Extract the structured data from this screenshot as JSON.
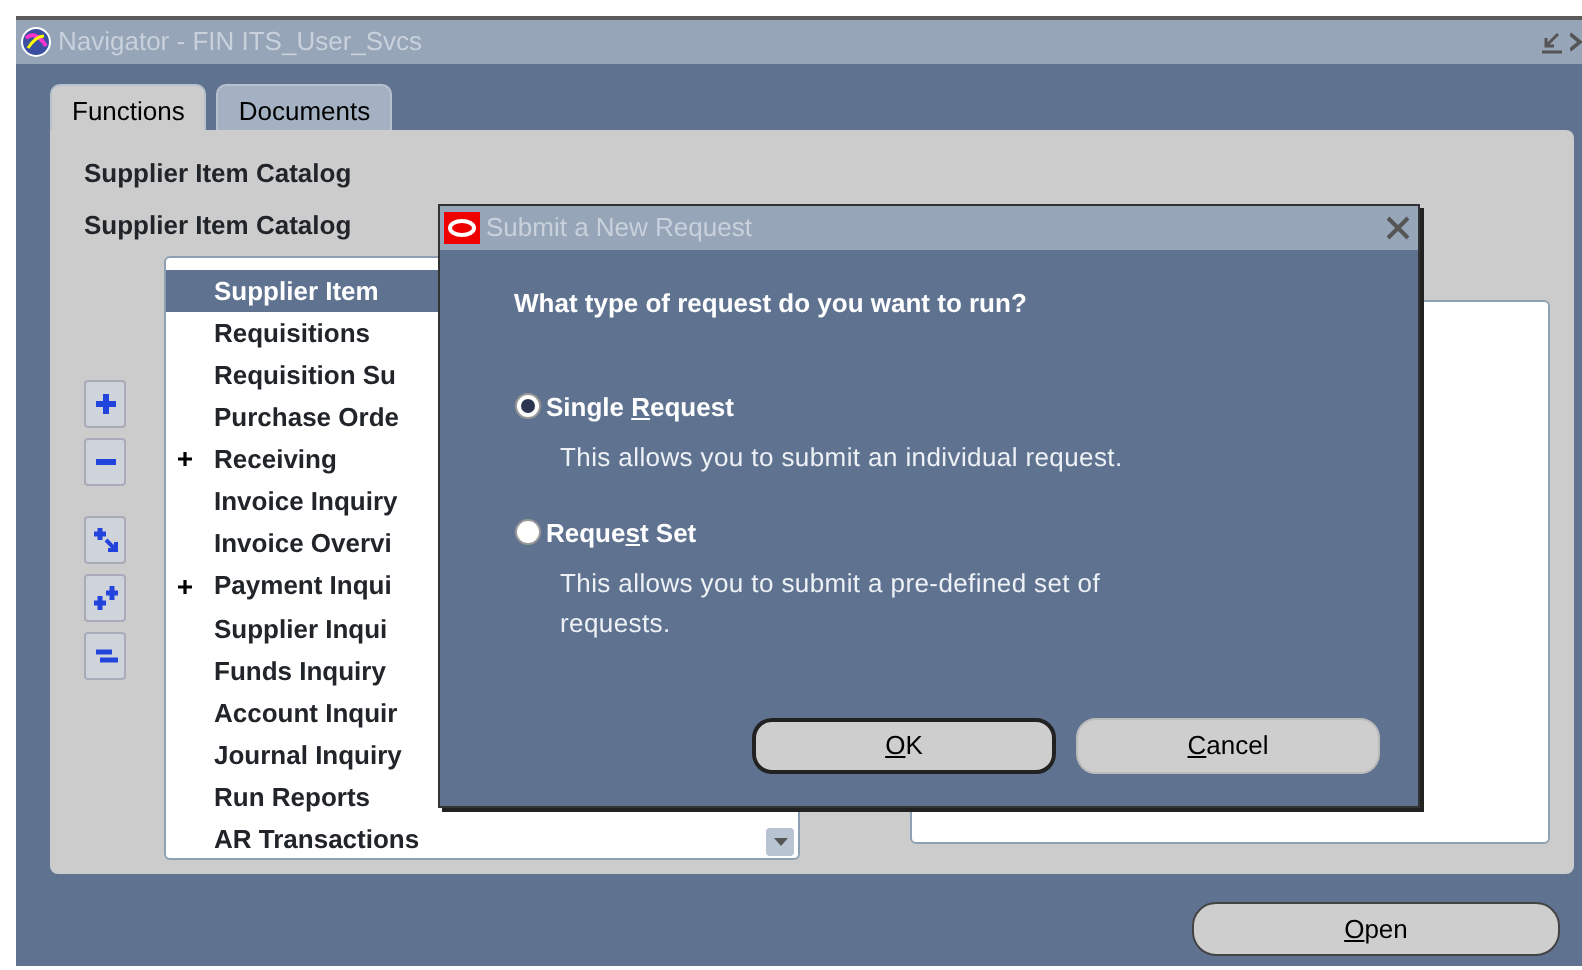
{
  "window": {
    "title": "Navigator - FIN ITS_User_Svcs"
  },
  "tabs": [
    {
      "label": "Functions",
      "selected": true
    },
    {
      "label": "Documents",
      "selected": false
    }
  ],
  "headings": [
    "Supplier Item Catalog",
    "Supplier Item Catalog"
  ],
  "tree_tools": [
    {
      "kind": "expand"
    },
    {
      "kind": "collapse"
    },
    {
      "kind": "expand_branch"
    },
    {
      "kind": "expand_all"
    },
    {
      "kind": "collapse_all"
    }
  ],
  "tree": {
    "items": [
      {
        "label": "Supplier Item",
        "selected": true,
        "collapsed": false
      },
      {
        "label": "Requisitions",
        "selected": false,
        "collapsed": false
      },
      {
        "label": "Requisition Su",
        "selected": false,
        "collapsed": false
      },
      {
        "label": "Purchase Orde",
        "selected": false,
        "collapsed": false
      },
      {
        "label": "Receiving",
        "selected": false,
        "collapsed": true
      },
      {
        "label": "Invoice Inquiry",
        "selected": false,
        "collapsed": false
      },
      {
        "label": "Invoice Overvi",
        "selected": false,
        "collapsed": false
      },
      {
        "label": "Payment Inqui",
        "selected": false,
        "collapsed": true
      },
      {
        "label": "Supplier Inqui",
        "selected": false,
        "collapsed": false
      },
      {
        "label": "Funds Inquiry",
        "selected": false,
        "collapsed": false
      },
      {
        "label": "Account Inquir",
        "selected": false,
        "collapsed": false
      },
      {
        "label": "Journal Inquiry",
        "selected": false,
        "collapsed": false
      },
      {
        "label": "Run Reports",
        "selected": false,
        "collapsed": false
      },
      {
        "label": "AR Transactions",
        "selected": false,
        "collapsed": false
      }
    ]
  },
  "open_button": {
    "label_parts": [
      {
        "text": "O",
        "underlined": true
      },
      {
        "text": "pen",
        "underlined": false
      }
    ]
  },
  "dialog": {
    "title": "Submit a New Request",
    "question": "What type of request do you want to run?",
    "options": [
      {
        "label_parts": [
          {
            "text": "Single ",
            "underlined": false
          },
          {
            "text": "R",
            "underlined": true
          },
          {
            "text": "equest",
            "underlined": false
          }
        ],
        "description": "This allows you to submit an individual request.",
        "selected": true
      },
      {
        "label_parts": [
          {
            "text": "Reque",
            "underlined": false
          },
          {
            "text": "s",
            "underlined": true
          },
          {
            "text": "t Set",
            "underlined": false
          }
        ],
        "description": "This allows you to submit a pre-defined set of requests.",
        "selected": false
      }
    ],
    "buttons": [
      {
        "label_parts": [
          {
            "text": "O",
            "underlined": true
          },
          {
            "text": "K",
            "underlined": false
          }
        ],
        "default": true
      },
      {
        "label_parts": [
          {
            "text": "C",
            "underlined": true
          },
          {
            "text": "ancel",
            "underlined": false
          }
        ],
        "default": false
      }
    ]
  }
}
